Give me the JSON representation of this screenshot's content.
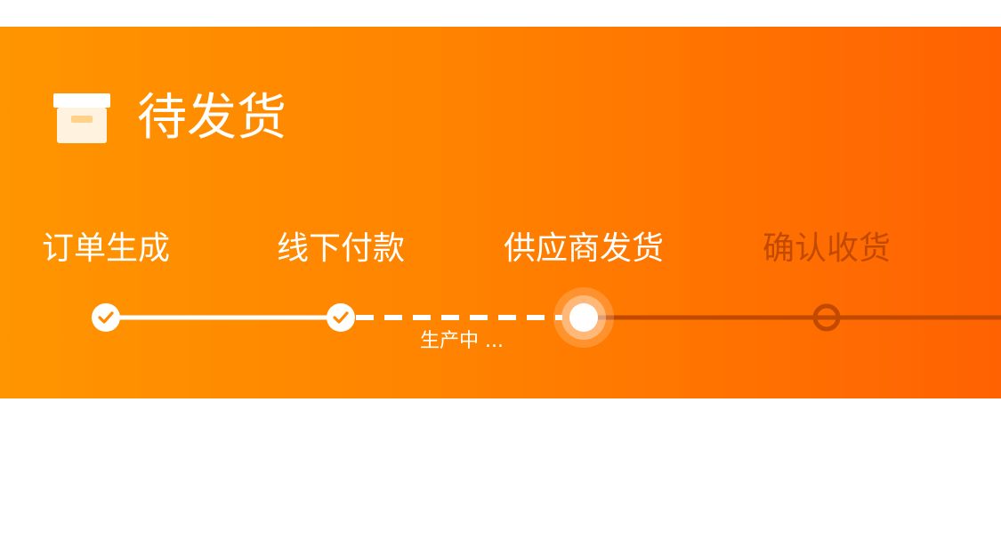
{
  "status": {
    "title": "待发货",
    "icon": "archive-box-icon"
  },
  "steps": [
    {
      "label": "订单生成",
      "state": "done"
    },
    {
      "label": "线下付款",
      "state": "done"
    },
    {
      "label": "供应商发货",
      "state": "current"
    },
    {
      "label": "确认收货",
      "state": "pending"
    }
  ],
  "progress": {
    "sub_status": "生产中 ..."
  },
  "colors": {
    "gradient_start": "#ff9500",
    "gradient_end": "#ff6202",
    "done": "#ffffff",
    "pending": "#c24a00"
  }
}
